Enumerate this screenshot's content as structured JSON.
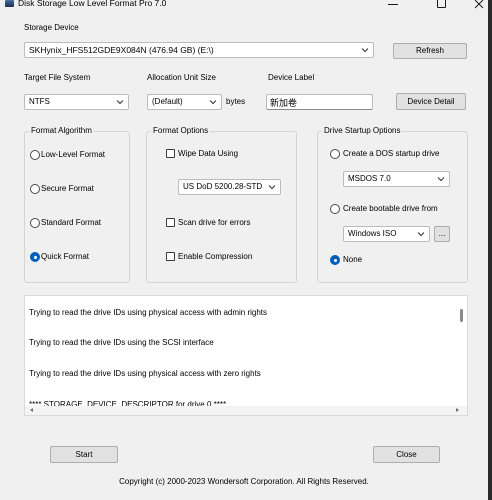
{
  "window": {
    "title": "Disk Storage Low Level Format Pro 7.0",
    "icons": [
      "app-icon",
      "minimize-icon",
      "maximize-icon",
      "close-icon"
    ]
  },
  "storage_device": {
    "label": "Storage Device",
    "selected": "SKHynix_HFS512GDE9X084N (476.94 GB) (E:\\)",
    "refresh_button": "Refresh"
  },
  "target_file_system": {
    "label": "Target File System",
    "selected": "NTFS"
  },
  "allocation_unit_size": {
    "label": "Allocation Unit Size",
    "selected": "(Default)",
    "unit": "bytes"
  },
  "device_label": {
    "label": "Device Label",
    "value": "新加卷"
  },
  "device_detail_button": "Device Detail",
  "format_algorithm": {
    "title": "Format Algorithm",
    "options": [
      {
        "label": "Low-Level Format",
        "checked": false
      },
      {
        "label": "Secure Format",
        "checked": false
      },
      {
        "label": "Standard Format",
        "checked": false
      },
      {
        "label": "Quick Format",
        "checked": true
      }
    ]
  },
  "format_options": {
    "title": "Format Options",
    "wipe_data": {
      "label": "Wipe Data Using",
      "checked": false,
      "method": "US DoD 5200.28-STD"
    },
    "scan_errors": {
      "label": "Scan drive for errors",
      "checked": false
    },
    "compression": {
      "label": "Enable Compression",
      "checked": false
    }
  },
  "drive_startup": {
    "title": "Drive Startup Options",
    "dos": {
      "label": "Create a DOS startup drive",
      "checked": false,
      "version": "MSDOS 7.0"
    },
    "bootable": {
      "label": "Create bootable drive from",
      "checked": false,
      "source": "Windows ISO",
      "browse_button": "..."
    },
    "none": {
      "label": "None",
      "checked": true
    }
  },
  "log": {
    "lines": [
      "Trying to read the drive IDs using physical access with admin rights",
      "Trying to read the drive IDs using the SCSI interface",
      "Trying to read the drive IDs using physical access with zero rights",
      "**** STORAGE_DEVICE_DESCRIPTOR for drive 0 ****"
    ]
  },
  "buttons": {
    "start": "Start",
    "close": "Close"
  },
  "footer": "Copyright (c) 2000-2023 Wondersoft Corporation. All Rights Reserved.",
  "colors": {
    "accent": "#005fb8",
    "background": "#f0f0f0",
    "button": "#e1e1e1"
  }
}
